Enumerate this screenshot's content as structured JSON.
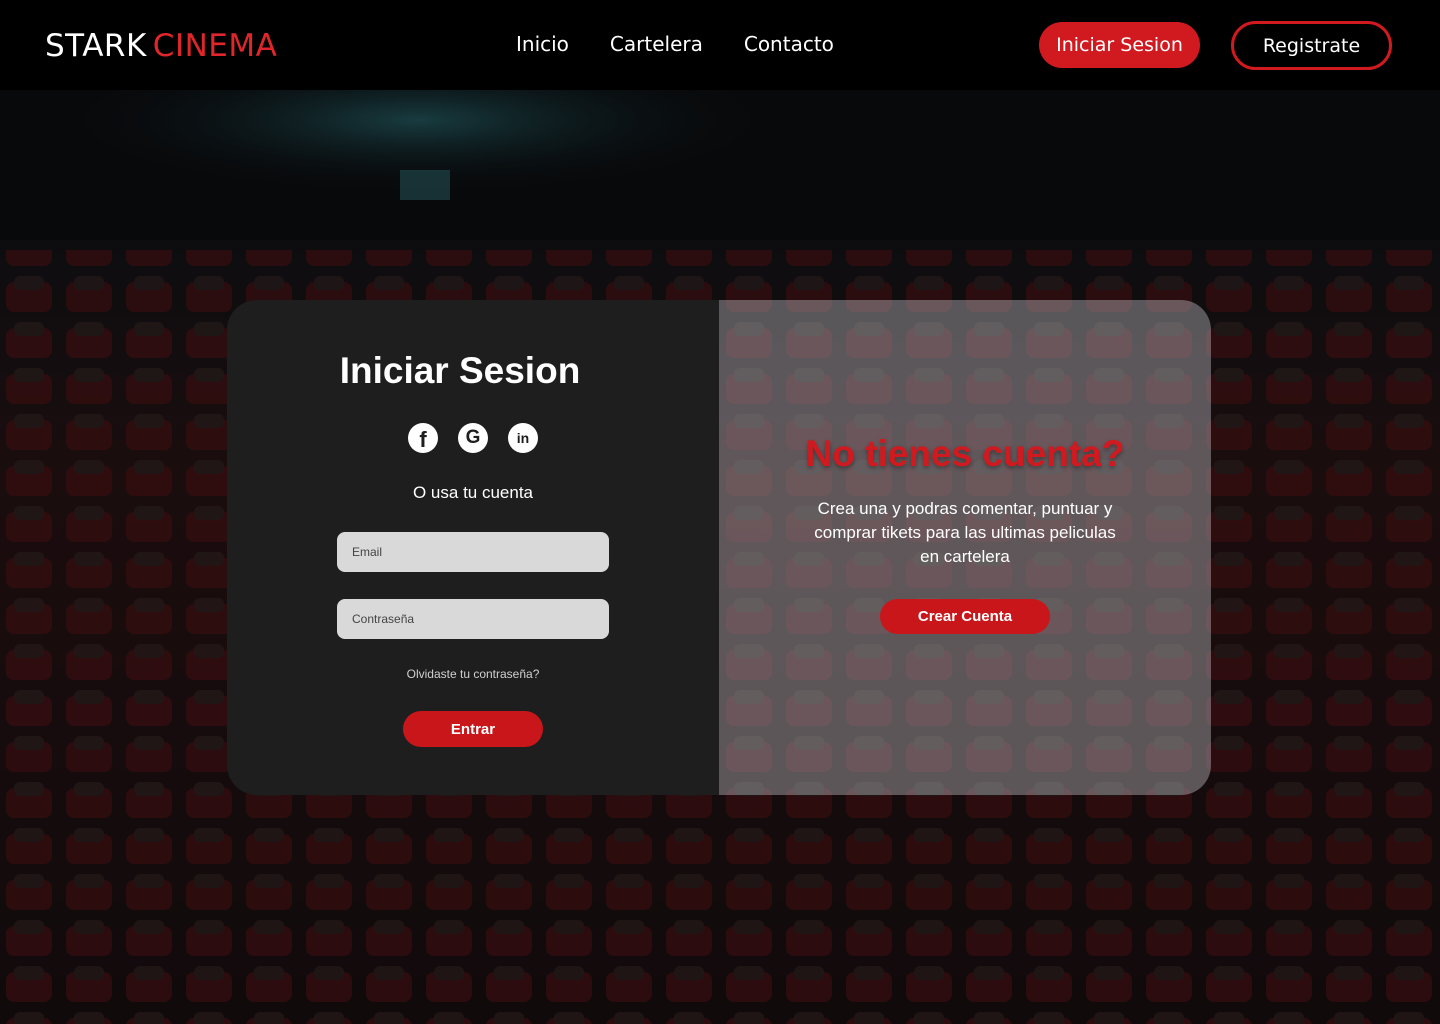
{
  "brand": {
    "name_part1": "STARK",
    "name_part2": "CINEMA"
  },
  "nav": {
    "links": [
      {
        "label": "Inicio"
      },
      {
        "label": "Cartelera"
      },
      {
        "label": "Contacto"
      }
    ],
    "login_label": "Iniciar Sesion",
    "register_label": "Registrate"
  },
  "login": {
    "title": "Iniciar Sesion",
    "social": [
      {
        "icon": "facebook-icon",
        "glyph": "f"
      },
      {
        "icon": "google-icon",
        "glyph": "G"
      },
      {
        "icon": "linkedin-icon",
        "glyph": "in"
      }
    ],
    "alt_text": "O usa tu cuenta",
    "email_placeholder": "Email",
    "password_placeholder": "Contraseña",
    "forgot_label": "Olvidaste tu contraseña?",
    "submit_label": "Entrar"
  },
  "signup_promo": {
    "title": "No tienes cuenta?",
    "text": "Crea una y podras comentar, puntuar y comprar tikets para las ultimas peliculas en cartelera",
    "button_label": "Crear Cuenta"
  },
  "colors": {
    "accent": "#d11a1f",
    "nav_bg": "#000000",
    "card_dark": "#1e1e1e",
    "input_bg": "#d9d9d9"
  }
}
